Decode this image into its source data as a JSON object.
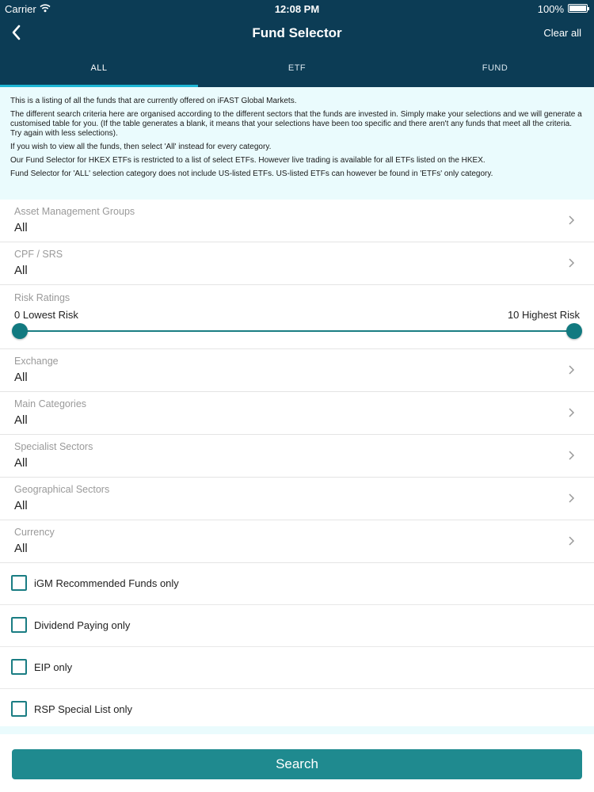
{
  "status_bar": {
    "carrier": "Carrier",
    "time": "12:08 PM",
    "battery": "100%"
  },
  "nav": {
    "title": "Fund Selector",
    "clear_label": "Clear all"
  },
  "tabs": [
    {
      "label": "ALL",
      "active": true
    },
    {
      "label": "ETF",
      "active": false
    },
    {
      "label": "FUND",
      "active": false
    }
  ],
  "info": {
    "p1": "This is a listing of all the funds that are currently offered on iFAST Global Markets.",
    "p2": "The different search criteria here are organised according to the different sectors that the funds are invested in. Simply make your selections and we will generate a customised table for you. (If the table generates a blank, it means that your selections have been too specific and there aren't any funds that meet all the criteria. Try again with less selections).",
    "p3": "If you wish to view all the funds, then select 'All' instead for every category.",
    "p4": "Our Fund Selector for HKEX ETFs is restricted to a list of select ETFs. However live trading is available for all ETFs listed on the HKEX.",
    "p5": "Fund Selector for 'ALL' selection category does not include US-listed ETFs. US-listed ETFs can however be found in 'ETFs' only category."
  },
  "filters": {
    "asset_management": {
      "label": "Asset Management Groups",
      "value": "All"
    },
    "cpf_srs": {
      "label": "CPF / SRS",
      "value": "All"
    },
    "risk": {
      "label": "Risk Ratings",
      "min_label": "0 Lowest Risk",
      "max_label": "10 Highest Risk",
      "min": 0,
      "max": 10
    },
    "exchange": {
      "label": "Exchange",
      "value": "All"
    },
    "main_categories": {
      "label": "Main Categories",
      "value": "All"
    },
    "specialist_sectors": {
      "label": "Specialist Sectors",
      "value": "All"
    },
    "geographical_sectors": {
      "label": "Geographical Sectors",
      "value": "All"
    },
    "currency": {
      "label": "Currency",
      "value": "All"
    }
  },
  "checkboxes": {
    "igm_recommended": {
      "label": "iGM Recommended Funds only",
      "checked": false
    },
    "dividend_paying": {
      "label": "Dividend Paying only",
      "checked": false
    },
    "eip_only": {
      "label": "EIP only",
      "checked": false
    },
    "rsp_special": {
      "label": "RSP Special List only",
      "checked": false
    }
  },
  "footer": {
    "search_label": "Search"
  },
  "colors": {
    "header_bg": "#0c3c55",
    "tab_indicator": "#1eb6d4",
    "accent": "#1f8a8f",
    "info_bg": "#eafbfd"
  },
  "icons": {
    "back": "chevron-left-icon",
    "row_arrow": "chevron-right-icon",
    "wifi": "wifi-icon",
    "battery": "battery-icon"
  }
}
